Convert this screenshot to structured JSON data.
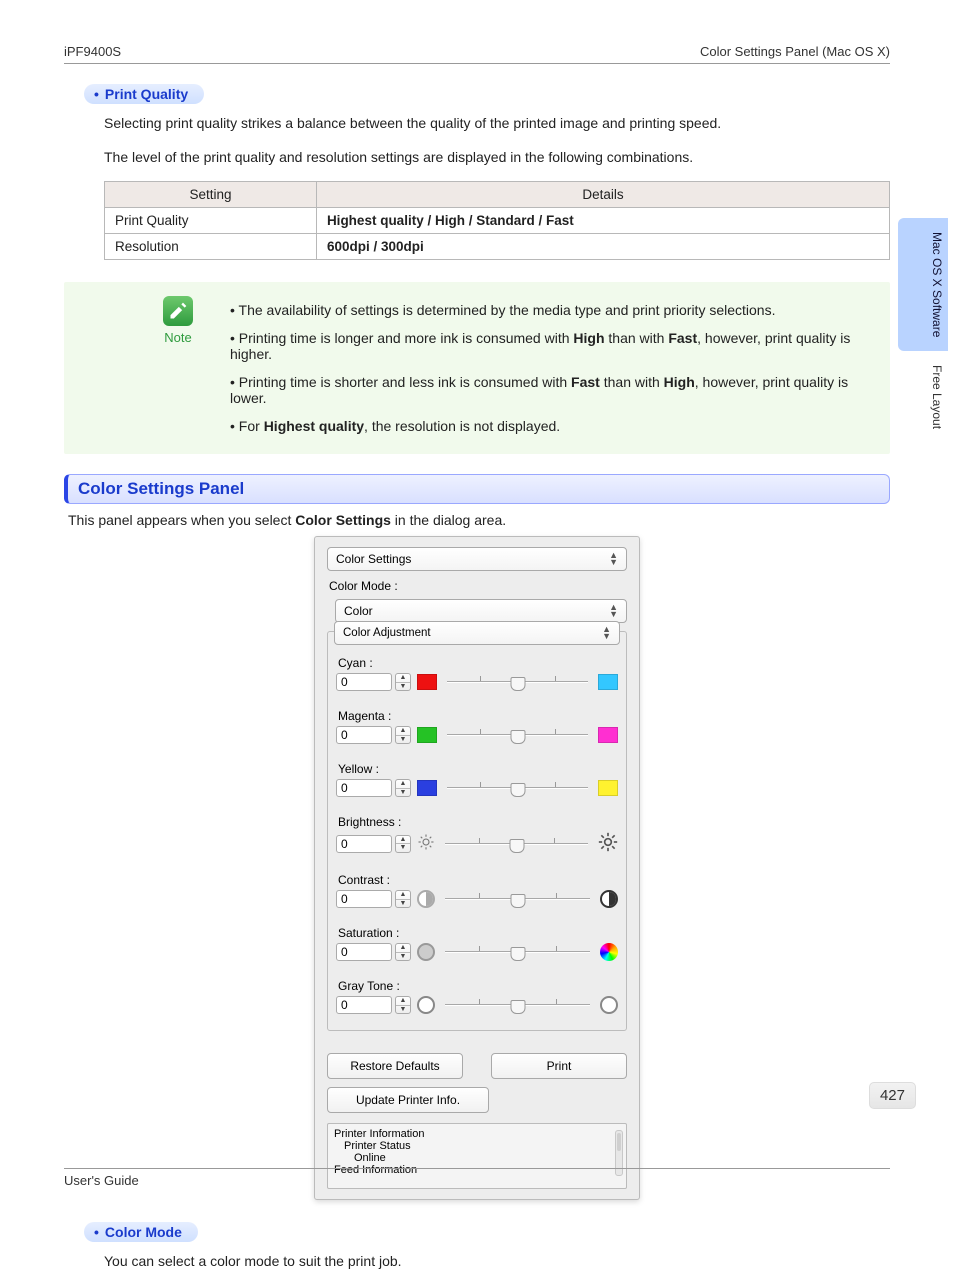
{
  "header": {
    "left": "iPF9400S",
    "right": "Color Settings Panel (Mac OS X)"
  },
  "sideTabs": {
    "active": "Mac OS X Software",
    "inactive": "Free Layout"
  },
  "printQuality": {
    "heading": "Print Quality",
    "p1": "Selecting print quality strikes a balance between the quality of the printed image and printing speed.",
    "p2": "The level of the print quality and resolution settings are displayed in the following combinations."
  },
  "table": {
    "h1": "Setting",
    "h2": "Details",
    "rows": [
      {
        "setting": "Print Quality",
        "details": "Highest quality / High / Standard / Fast"
      },
      {
        "setting": "Resolution",
        "details": "600dpi / 300dpi"
      }
    ]
  },
  "note": {
    "label": "Note",
    "items": [
      "The availability of settings is determined by the media type and print priority selections.",
      "Printing time is longer and more ink is consumed with <b>High</b> than with <b>Fast</b>, however, print quality is higher.",
      "Printing time is shorter and less ink is consumed with <b>Fast</b> than with <b>High</b>, however, print quality is lower.",
      "For <b>Highest quality</b>, the resolution is not displayed."
    ]
  },
  "section": {
    "title": "Color Settings Panel",
    "intro_pre": "This panel appears when you select ",
    "intro_bold": "Color Settings",
    "intro_post": " in the dialog area."
  },
  "panel": {
    "topSelect": "Color Settings",
    "colorModeLabel": "Color Mode :",
    "colorModeValue": "Color",
    "fieldset": "Color Adjustment",
    "sliders": [
      {
        "label": "Cyan :",
        "value": "0",
        "left": "#e11",
        "right": "#33c7ff",
        "type": "swatch"
      },
      {
        "label": "Magenta :",
        "value": "0",
        "left": "#25c225",
        "right": "#ff2fd1",
        "type": "swatch"
      },
      {
        "label": "Yellow :",
        "value": "0",
        "left": "#2a3fe0",
        "right": "#fff22f",
        "type": "swatch"
      },
      {
        "label": "Brightness :",
        "value": "0",
        "left": "sun-dim",
        "right": "sun-bright",
        "type": "icon"
      },
      {
        "label": "Contrast :",
        "value": "0",
        "left": "contrast-low",
        "right": "contrast-high",
        "type": "icon"
      },
      {
        "label": "Saturation :",
        "value": "0",
        "left": "gray-circle",
        "right": "rainbow",
        "type": "icon"
      },
      {
        "label": "Gray Tone :",
        "value": "0",
        "left": "empty-circle",
        "right": "empty-circle",
        "type": "icon"
      }
    ],
    "restore": "Restore Defaults",
    "print": "Print",
    "update": "Update Printer Info.",
    "info": {
      "l1": "Printer Information",
      "l2": "Printer Status",
      "l3": "Online",
      "l4": "Feed Information"
    }
  },
  "colorMode": {
    "heading": "Color Mode",
    "text": "You can select a color mode to suit the print job."
  },
  "pageNumber": "427",
  "footer": "User's Guide"
}
